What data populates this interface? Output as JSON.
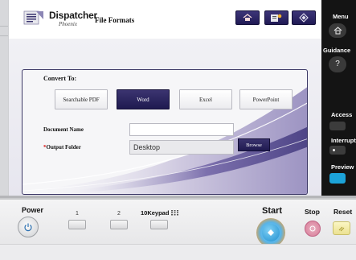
{
  "header": {
    "brand": "Dispatcher",
    "brand_sub": "Phoenix",
    "page_title": "File Formats",
    "buttons": [
      "home-icon",
      "scan-settings-icon",
      "diamond-icon"
    ]
  },
  "convert": {
    "label": "Convert To:",
    "formats": [
      {
        "label": "Searchable PDF",
        "selected": false
      },
      {
        "label": "Word",
        "selected": true
      },
      {
        "label": "Excel",
        "selected": false
      },
      {
        "label": "PowerPoint",
        "selected": false
      }
    ]
  },
  "fields": {
    "document_name_label": "Document Name",
    "document_name_value": "",
    "output_folder_required": "*",
    "output_folder_label": "Output Folder",
    "output_folder_value": "Desktop",
    "browse_label": "Browse"
  },
  "sidebar": {
    "menu": "Menu",
    "guidance": "Guidance",
    "guidance_symbol": "?",
    "access": "Access",
    "interrupt": "Interrupt",
    "preview": "Preview"
  },
  "bottom": {
    "power": "Power",
    "key1": "1",
    "key2": "2",
    "keypad": "10Keypad",
    "start": "Start",
    "stop": "Stop",
    "reset": "Reset"
  },
  "colors": {
    "accent": "#2b245f",
    "sidebar_bg": "#141414",
    "preview": "#1ca3d9",
    "start": "#1f8fcf"
  }
}
